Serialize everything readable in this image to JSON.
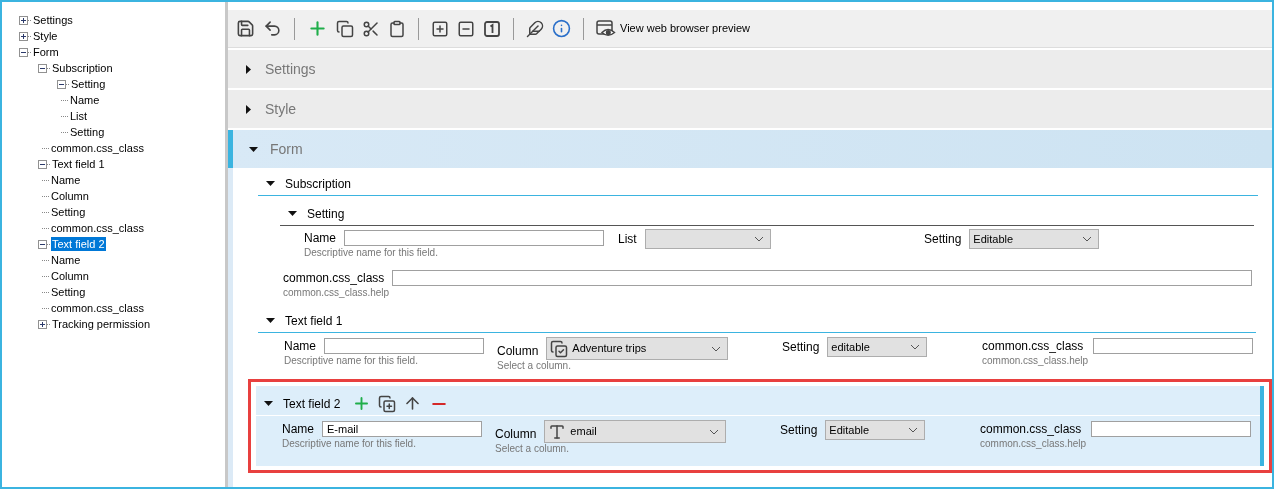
{
  "tree": [
    {
      "label": "Settings",
      "expanded": false,
      "selected": false
    },
    {
      "label": "Style",
      "expanded": false,
      "selected": false
    },
    {
      "label": "Form",
      "expanded": true,
      "selected": false,
      "children": [
        {
          "label": "Subscription",
          "expanded": true,
          "selected": false,
          "children": [
            {
              "label": "Setting",
              "expanded": true,
              "selected": false,
              "children": [
                {
                  "label": "Name",
                  "selected": false
                },
                {
                  "label": "List",
                  "selected": false
                },
                {
                  "label": "Setting",
                  "selected": false
                }
              ]
            },
            {
              "label": "common.css_class",
              "selected": false
            }
          ]
        },
        {
          "label": "Text field 1",
          "expanded": true,
          "selected": false,
          "children": [
            {
              "label": "Name",
              "selected": false
            },
            {
              "label": "Column",
              "selected": false
            },
            {
              "label": "Setting",
              "selected": false
            },
            {
              "label": "common.css_class",
              "selected": false
            }
          ]
        },
        {
          "label": "Text field 2",
          "expanded": true,
          "selected": true,
          "children": [
            {
              "label": "Name",
              "selected": false
            },
            {
              "label": "Column",
              "selected": false
            },
            {
              "label": "Setting",
              "selected": false
            },
            {
              "label": "common.css_class",
              "selected": false
            }
          ]
        },
        {
          "label": "Tracking permission",
          "expanded": false,
          "selected": false
        }
      ]
    }
  ],
  "toolbar": {
    "items": [
      {
        "kind": "save"
      },
      {
        "kind": "undo"
      },
      {
        "kind": "separator"
      },
      {
        "kind": "add"
      },
      {
        "kind": "copy"
      },
      {
        "kind": "cut"
      },
      {
        "kind": "paste"
      },
      {
        "kind": "separator"
      },
      {
        "kind": "expand"
      },
      {
        "kind": "collapse"
      },
      {
        "kind": "one"
      },
      {
        "kind": "separator"
      },
      {
        "kind": "feather"
      },
      {
        "kind": "info"
      },
      {
        "kind": "separator"
      }
    ],
    "preview_label": "View web browser preview"
  },
  "sections": [
    {
      "title": "Settings",
      "expanded": false,
      "selected": false
    },
    {
      "title": "Style",
      "expanded": false,
      "selected": false
    },
    {
      "title": "Form",
      "expanded": true,
      "selected": true
    }
  ],
  "subscription": {
    "title": "Subscription",
    "expanded": true,
    "setting": {
      "title": "Setting",
      "expanded": true,
      "name": {
        "label": "Name",
        "help": "Descriptive name for this field."
      },
      "list": {
        "label": "List"
      },
      "setting": {
        "label": "Setting",
        "value": "Editable"
      }
    },
    "css_class": {
      "label": "common.css_class",
      "help": "common.css_class.help"
    }
  },
  "text_fields": [
    {
      "title": "Text field 1",
      "expanded": true,
      "selected": false,
      "name": {
        "label": "Name",
        "help": "Descriptive name for this field."
      },
      "column": {
        "label": "Column",
        "kind": "checkbox",
        "value": "Adventure trips",
        "help": "Select a column."
      },
      "setting": {
        "label": "Setting",
        "value": "editable"
      },
      "css_class": {
        "label": "common.css_class",
        "help": "common.css_class.help"
      }
    },
    {
      "title": "Text field 2",
      "expanded": true,
      "selected": true,
      "name": {
        "label": "Name",
        "value": "E-mail",
        "help": "Descriptive name for this field."
      },
      "column": {
        "label": "Column",
        "kind": "text",
        "value": "email",
        "help": "Select a column."
      },
      "setting": {
        "label": "Setting",
        "value": "Editable"
      },
      "css_class": {
        "label": "common.css_class",
        "help": "common.css_class.help"
      }
    }
  ]
}
